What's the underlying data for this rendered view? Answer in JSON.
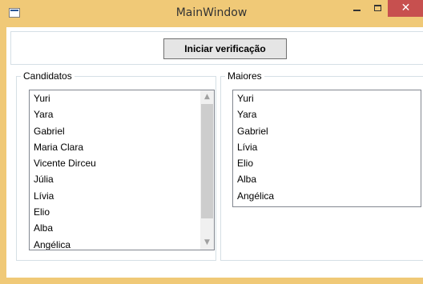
{
  "window": {
    "title": "MainWindow",
    "minimize_icon": "minimize-icon",
    "maximize_icon": "maximize-icon",
    "close_icon": "close-icon",
    "close_glyph": "✕",
    "accent_close": "#c7504f",
    "frame_color": "#f0c977"
  },
  "toolbar": {
    "verify_label": "Iniciar verificação"
  },
  "candidatos": {
    "legend": "Candidatos",
    "items": [
      "Yuri",
      "Yara",
      "Gabriel",
      "Maria Clara",
      "Vicente Dirceu",
      "Júlia",
      "Lívia",
      "Elio",
      "Alba",
      "Angélica"
    ],
    "scroll_up": "▲",
    "scroll_down": "▼"
  },
  "maiores": {
    "legend": "Maiores",
    "items": [
      "Yuri",
      "Yara",
      "Gabriel",
      "Lívia",
      "Elio",
      "Alba",
      "Angélica"
    ]
  }
}
